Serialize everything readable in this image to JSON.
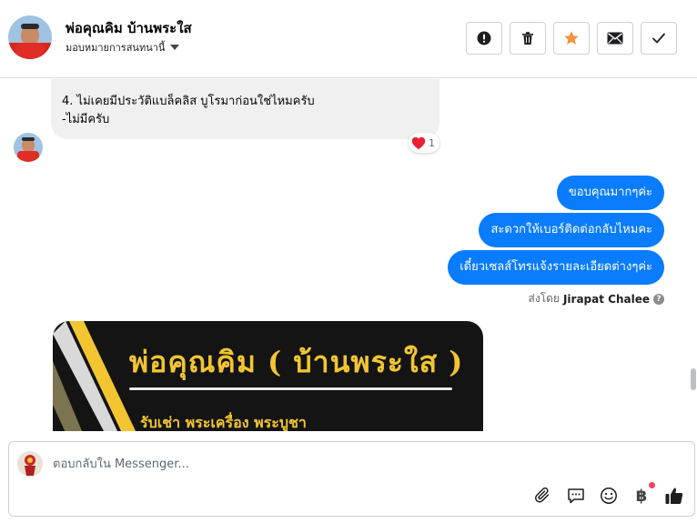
{
  "header": {
    "contact_name": "พ่อคุณคิม บ้านพระใส",
    "assign_label": "มอบหมายการสนทนานี้",
    "actions": [
      {
        "name": "report-button",
        "icon": "exclamation-icon"
      },
      {
        "name": "delete-button",
        "icon": "trash-icon"
      },
      {
        "name": "star-button",
        "icon": "star-icon"
      },
      {
        "name": "mark-unread-button",
        "icon": "envelope-icon"
      },
      {
        "name": "mark-done-button",
        "icon": "checkmark-icon"
      }
    ]
  },
  "conversation": {
    "received": {
      "line1": "4. ไม่เคยมีประวัติแบล็คลิส บูโรมาก่อนใช่ไหมครับ",
      "line2": "-ไม่มีครับ",
      "reaction_emoji": "heart",
      "reaction_count": "1"
    },
    "sent": [
      "ขอบคุณมากๆค่ะ",
      "สะดวกให้เบอร์ติดต่อกลับไหมคะ",
      "เดี๋ยวเซลส์โทรแจ้งรายละเอียดต่างๆค่ะ"
    ],
    "sent_by_prefix": "ส่งโดย",
    "sent_by_name": "Jirapat Chalee",
    "image_card": {
      "title": "พ่อคุณคิม ( บ้านพระใส )",
      "subtitle": "รับเช่า พระเครื่อง พระบูชา"
    }
  },
  "composer": {
    "placeholder": "ตอบกลับใน Messenger...",
    "value": ""
  },
  "colors": {
    "sent_bubble": "#0a7cff",
    "received_bubble": "#f0f0f0",
    "star": "#f7923b",
    "card_gold": "#f2c531"
  }
}
